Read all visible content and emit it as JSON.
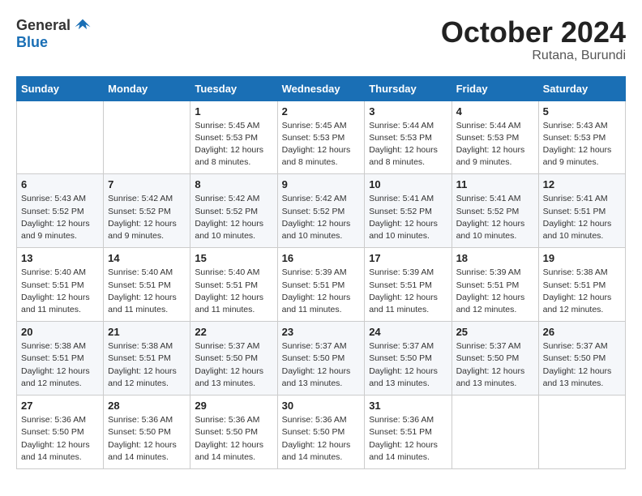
{
  "logo": {
    "general": "General",
    "blue": "Blue"
  },
  "header": {
    "month": "October 2024",
    "location": "Rutana, Burundi"
  },
  "weekdays": [
    "Sunday",
    "Monday",
    "Tuesday",
    "Wednesday",
    "Thursday",
    "Friday",
    "Saturday"
  ],
  "weeks": [
    [
      {
        "day": "",
        "info": ""
      },
      {
        "day": "",
        "info": ""
      },
      {
        "day": "1",
        "info": "Sunrise: 5:45 AM\nSunset: 5:53 PM\nDaylight: 12 hours and 8 minutes."
      },
      {
        "day": "2",
        "info": "Sunrise: 5:45 AM\nSunset: 5:53 PM\nDaylight: 12 hours and 8 minutes."
      },
      {
        "day": "3",
        "info": "Sunrise: 5:44 AM\nSunset: 5:53 PM\nDaylight: 12 hours and 8 minutes."
      },
      {
        "day": "4",
        "info": "Sunrise: 5:44 AM\nSunset: 5:53 PM\nDaylight: 12 hours and 9 minutes."
      },
      {
        "day": "5",
        "info": "Sunrise: 5:43 AM\nSunset: 5:53 PM\nDaylight: 12 hours and 9 minutes."
      }
    ],
    [
      {
        "day": "6",
        "info": "Sunrise: 5:43 AM\nSunset: 5:52 PM\nDaylight: 12 hours and 9 minutes."
      },
      {
        "day": "7",
        "info": "Sunrise: 5:42 AM\nSunset: 5:52 PM\nDaylight: 12 hours and 9 minutes."
      },
      {
        "day": "8",
        "info": "Sunrise: 5:42 AM\nSunset: 5:52 PM\nDaylight: 12 hours and 10 minutes."
      },
      {
        "day": "9",
        "info": "Sunrise: 5:42 AM\nSunset: 5:52 PM\nDaylight: 12 hours and 10 minutes."
      },
      {
        "day": "10",
        "info": "Sunrise: 5:41 AM\nSunset: 5:52 PM\nDaylight: 12 hours and 10 minutes."
      },
      {
        "day": "11",
        "info": "Sunrise: 5:41 AM\nSunset: 5:52 PM\nDaylight: 12 hours and 10 minutes."
      },
      {
        "day": "12",
        "info": "Sunrise: 5:41 AM\nSunset: 5:51 PM\nDaylight: 12 hours and 10 minutes."
      }
    ],
    [
      {
        "day": "13",
        "info": "Sunrise: 5:40 AM\nSunset: 5:51 PM\nDaylight: 12 hours and 11 minutes."
      },
      {
        "day": "14",
        "info": "Sunrise: 5:40 AM\nSunset: 5:51 PM\nDaylight: 12 hours and 11 minutes."
      },
      {
        "day": "15",
        "info": "Sunrise: 5:40 AM\nSunset: 5:51 PM\nDaylight: 12 hours and 11 minutes."
      },
      {
        "day": "16",
        "info": "Sunrise: 5:39 AM\nSunset: 5:51 PM\nDaylight: 12 hours and 11 minutes."
      },
      {
        "day": "17",
        "info": "Sunrise: 5:39 AM\nSunset: 5:51 PM\nDaylight: 12 hours and 11 minutes."
      },
      {
        "day": "18",
        "info": "Sunrise: 5:39 AM\nSunset: 5:51 PM\nDaylight: 12 hours and 12 minutes."
      },
      {
        "day": "19",
        "info": "Sunrise: 5:38 AM\nSunset: 5:51 PM\nDaylight: 12 hours and 12 minutes."
      }
    ],
    [
      {
        "day": "20",
        "info": "Sunrise: 5:38 AM\nSunset: 5:51 PM\nDaylight: 12 hours and 12 minutes."
      },
      {
        "day": "21",
        "info": "Sunrise: 5:38 AM\nSunset: 5:51 PM\nDaylight: 12 hours and 12 minutes."
      },
      {
        "day": "22",
        "info": "Sunrise: 5:37 AM\nSunset: 5:50 PM\nDaylight: 12 hours and 13 minutes."
      },
      {
        "day": "23",
        "info": "Sunrise: 5:37 AM\nSunset: 5:50 PM\nDaylight: 12 hours and 13 minutes."
      },
      {
        "day": "24",
        "info": "Sunrise: 5:37 AM\nSunset: 5:50 PM\nDaylight: 12 hours and 13 minutes."
      },
      {
        "day": "25",
        "info": "Sunrise: 5:37 AM\nSunset: 5:50 PM\nDaylight: 12 hours and 13 minutes."
      },
      {
        "day": "26",
        "info": "Sunrise: 5:37 AM\nSunset: 5:50 PM\nDaylight: 12 hours and 13 minutes."
      }
    ],
    [
      {
        "day": "27",
        "info": "Sunrise: 5:36 AM\nSunset: 5:50 PM\nDaylight: 12 hours and 14 minutes."
      },
      {
        "day": "28",
        "info": "Sunrise: 5:36 AM\nSunset: 5:50 PM\nDaylight: 12 hours and 14 minutes."
      },
      {
        "day": "29",
        "info": "Sunrise: 5:36 AM\nSunset: 5:50 PM\nDaylight: 12 hours and 14 minutes."
      },
      {
        "day": "30",
        "info": "Sunrise: 5:36 AM\nSunset: 5:50 PM\nDaylight: 12 hours and 14 minutes."
      },
      {
        "day": "31",
        "info": "Sunrise: 5:36 AM\nSunset: 5:51 PM\nDaylight: 12 hours and 14 minutes."
      },
      {
        "day": "",
        "info": ""
      },
      {
        "day": "",
        "info": ""
      }
    ]
  ]
}
